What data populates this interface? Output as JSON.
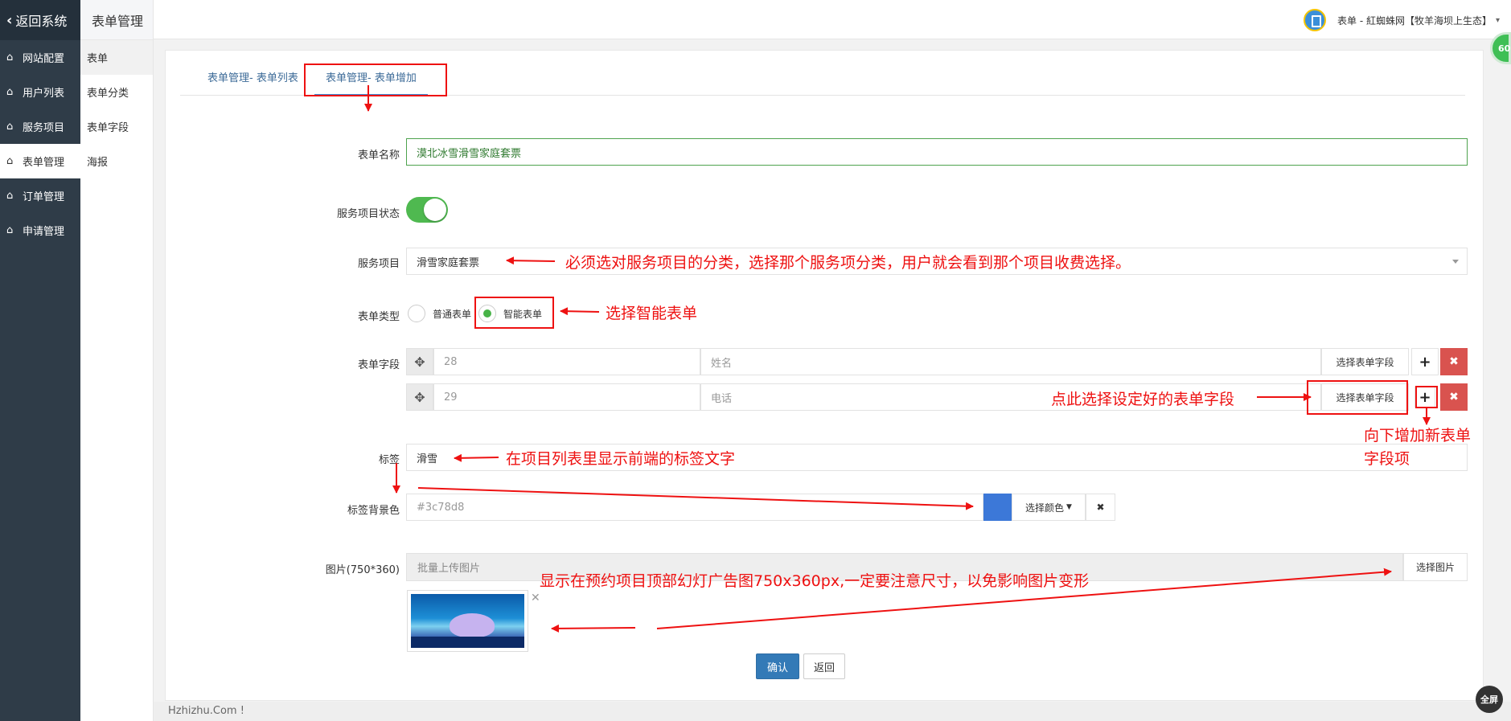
{
  "sidebar": {
    "back_label": "返回系统",
    "items": [
      {
        "label": "网站配置"
      },
      {
        "label": "用户列表"
      },
      {
        "label": "服务项目"
      },
      {
        "label": "表单管理"
      },
      {
        "label": "订单管理"
      },
      {
        "label": "申请管理"
      }
    ]
  },
  "subsidebar": {
    "title": "表单管理",
    "items": [
      {
        "label": "表单"
      },
      {
        "label": "表单分类"
      },
      {
        "label": "表单字段"
      },
      {
        "label": "海报"
      }
    ]
  },
  "header": {
    "user_label": "表单 - 紅蜘蛛网【牧羊海坝上生态】",
    "badge": "60"
  },
  "tabs": [
    {
      "label": "表单管理- 表单列表"
    },
    {
      "label": "表单管理- 表单增加"
    }
  ],
  "form": {
    "name_label": "表单名称",
    "name_value": "漠北冰雪滑雪家庭套票",
    "status_label": "服务项目状态",
    "service_label": "服务项目",
    "service_value": "滑雪家庭套票",
    "type_label": "表单类型",
    "type_options": [
      "普通表单",
      "智能表单"
    ],
    "type_selected": "智能表单",
    "fields_label": "表单字段",
    "fields": [
      {
        "id": "28",
        "name": "姓名",
        "select_label": "选择表单字段"
      },
      {
        "id": "29",
        "name": "电话",
        "select_label": "选择表单字段"
      }
    ],
    "tag_label": "标签",
    "tag_value": "滑雪",
    "tag_bg_label": "标签背景色",
    "tag_bg_value": "#3c78d8",
    "choose_color_label": "选择颜色",
    "image_label": "图片(750*360)",
    "image_placeholder": "批量上传图片",
    "choose_image_label": "选择图片",
    "confirm_label": "确认",
    "back_label": "返回"
  },
  "annotations": {
    "service_note": "必须选对服务项目的分类，选择那个服务项分类，用户就会看到那个项目收费选择。",
    "type_note": "选择智能表单",
    "field_note": "点此选择设定好的表单字段",
    "add_note_line1": "向下增加新表单",
    "add_note_line2": "字段项",
    "tag_note": "在项目列表里显示前端的标签文字",
    "image_note": "显示在预约项目顶部幻灯广告图750x360px,一定要注意尺寸，以免影响图片变形",
    "color": "#ee1111"
  },
  "footer": {
    "text": "Hzhizhu.Com !",
    "fullscreen_label": "全屏"
  }
}
